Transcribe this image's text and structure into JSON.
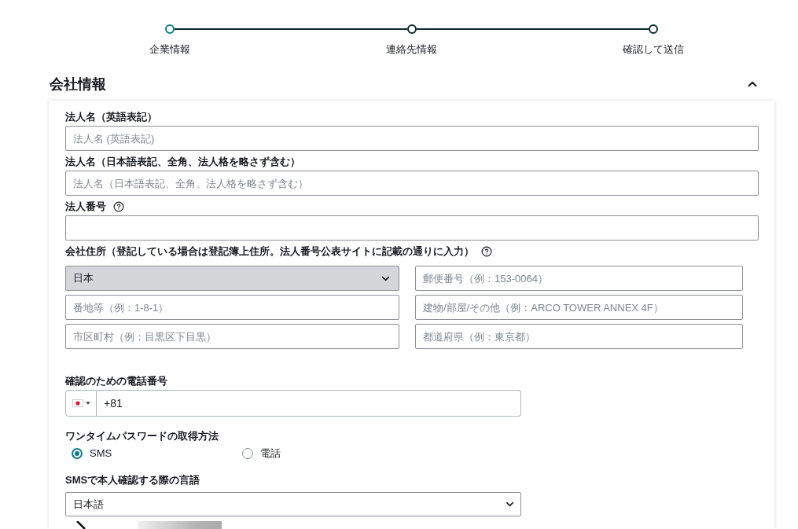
{
  "stepper": {
    "steps": [
      {
        "label": "企業情報",
        "selected": true
      },
      {
        "label": "連絡先情報",
        "selected": false
      },
      {
        "label": "確認して送信",
        "selected": false
      }
    ]
  },
  "section": {
    "title": "会社情報",
    "expanded": true,
    "fields": [
      {
        "kind": "text",
        "label": "法人名（英語表記）",
        "placeholder": "法人名 (英語表記)"
      },
      {
        "kind": "text",
        "label": "法人名（日本語表記、全角、法人格を略さず含む）",
        "placeholder": "法人名（日本語表記、全角、法人格を略さず含む）"
      },
      {
        "kind": "text",
        "label": "法人番号",
        "help": true
      },
      {
        "kind": "address",
        "label": "会社住所（登記している場合は登記簿上住所。法人番号公表サイトに記載の通りに入力）",
        "help": true,
        "country": "日本",
        "inputs": [
          {
            "placeholder": "郵便番号（例：153-0064）"
          },
          {
            "placeholder": "番地等（例：1-8-1）"
          },
          {
            "placeholder": "建物/部屋/その他（例：ARCO TOWER ANNEX 4F）"
          },
          {
            "placeholder": "市区町村（例：目黒区下目黒）"
          },
          {
            "placeholder": "都道府県（例：東京都）"
          }
        ]
      },
      {
        "kind": "phone",
        "label": "確認のための電話番号",
        "value": "+81"
      },
      {
        "kind": "radio",
        "label": "ワンタイムパスワードの取得方法",
        "options": [
          {
            "label": "SMS",
            "selected": true
          },
          {
            "label": "電話",
            "selected": false
          }
        ]
      },
      {
        "kind": "select",
        "label": "SMSで本人確認する際の言語",
        "value": "日本語"
      }
    ]
  }
}
